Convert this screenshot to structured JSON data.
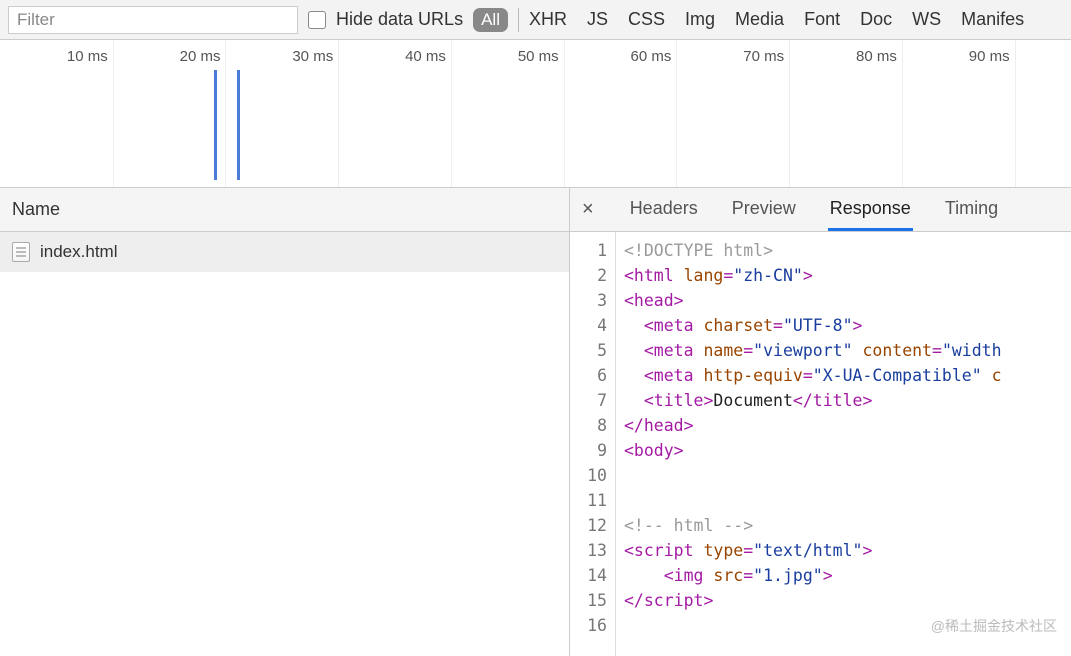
{
  "toolbar": {
    "filter_placeholder": "Filter",
    "hide_data_urls": "Hide data URLs",
    "all_label": "All",
    "types": [
      "XHR",
      "JS",
      "CSS",
      "Img",
      "Media",
      "Font",
      "Doc",
      "WS",
      "Manifes"
    ]
  },
  "timeline": {
    "ticks": [
      "10 ms",
      "20 ms",
      "30 ms",
      "40 ms",
      "50 ms",
      "60 ms",
      "70 ms",
      "80 ms",
      "90 ms"
    ],
    "bars_ms": [
      19,
      21
    ]
  },
  "name_col": {
    "header": "Name"
  },
  "requests": [
    {
      "name": "index.html"
    }
  ],
  "detail_tabs": [
    "Headers",
    "Preview",
    "Response",
    "Timing"
  ],
  "detail_active": "Response",
  "code_lines": {
    "1": [
      [
        "gray",
        "<!DOCTYPE html>"
      ]
    ],
    "2": [
      [
        "tag",
        "<html "
      ],
      [
        "attr",
        "lang"
      ],
      [
        "tag",
        "="
      ],
      [
        "str",
        "\"zh-CN\""
      ],
      [
        "tag",
        ">"
      ]
    ],
    "3": [
      [
        "tag",
        "<head>"
      ]
    ],
    "4": [
      [
        "text",
        "  "
      ],
      [
        "tag",
        "<meta "
      ],
      [
        "attr",
        "charset"
      ],
      [
        "tag",
        "="
      ],
      [
        "str",
        "\"UTF-8\""
      ],
      [
        "tag",
        ">"
      ]
    ],
    "5": [
      [
        "text",
        "  "
      ],
      [
        "tag",
        "<meta "
      ],
      [
        "attr",
        "name"
      ],
      [
        "tag",
        "="
      ],
      [
        "str",
        "\"viewport\""
      ],
      [
        "tag",
        " "
      ],
      [
        "attr",
        "content"
      ],
      [
        "tag",
        "="
      ],
      [
        "str",
        "\"width"
      ]
    ],
    "6": [
      [
        "text",
        "  "
      ],
      [
        "tag",
        "<meta "
      ],
      [
        "attr",
        "http-equiv"
      ],
      [
        "tag",
        "="
      ],
      [
        "str",
        "\"X-UA-Compatible\""
      ],
      [
        "tag",
        " "
      ],
      [
        "attr",
        "c"
      ]
    ],
    "7": [
      [
        "text",
        "  "
      ],
      [
        "tag",
        "<title>"
      ],
      [
        "text",
        "Document"
      ],
      [
        "tag",
        "</title>"
      ]
    ],
    "8": [
      [
        "tag",
        "</head>"
      ]
    ],
    "9": [
      [
        "tag",
        "<body>"
      ]
    ],
    "10": [],
    "11": [],
    "12": [
      [
        "gray",
        "<!-- html -->"
      ]
    ],
    "13": [
      [
        "tag",
        "<script "
      ],
      [
        "attr",
        "type"
      ],
      [
        "tag",
        "="
      ],
      [
        "str",
        "\"text/html\""
      ],
      [
        "tag",
        ">"
      ]
    ],
    "14": [
      [
        "text",
        "    "
      ],
      [
        "tag",
        "<img "
      ],
      [
        "attr",
        "src"
      ],
      [
        "tag",
        "="
      ],
      [
        "str",
        "\"1.jpg\""
      ],
      [
        "tag",
        ">"
      ]
    ],
    "15": [
      [
        "tag",
        "</script>"
      ]
    ],
    "16": []
  },
  "watermark": "@稀土掘金技术社区"
}
